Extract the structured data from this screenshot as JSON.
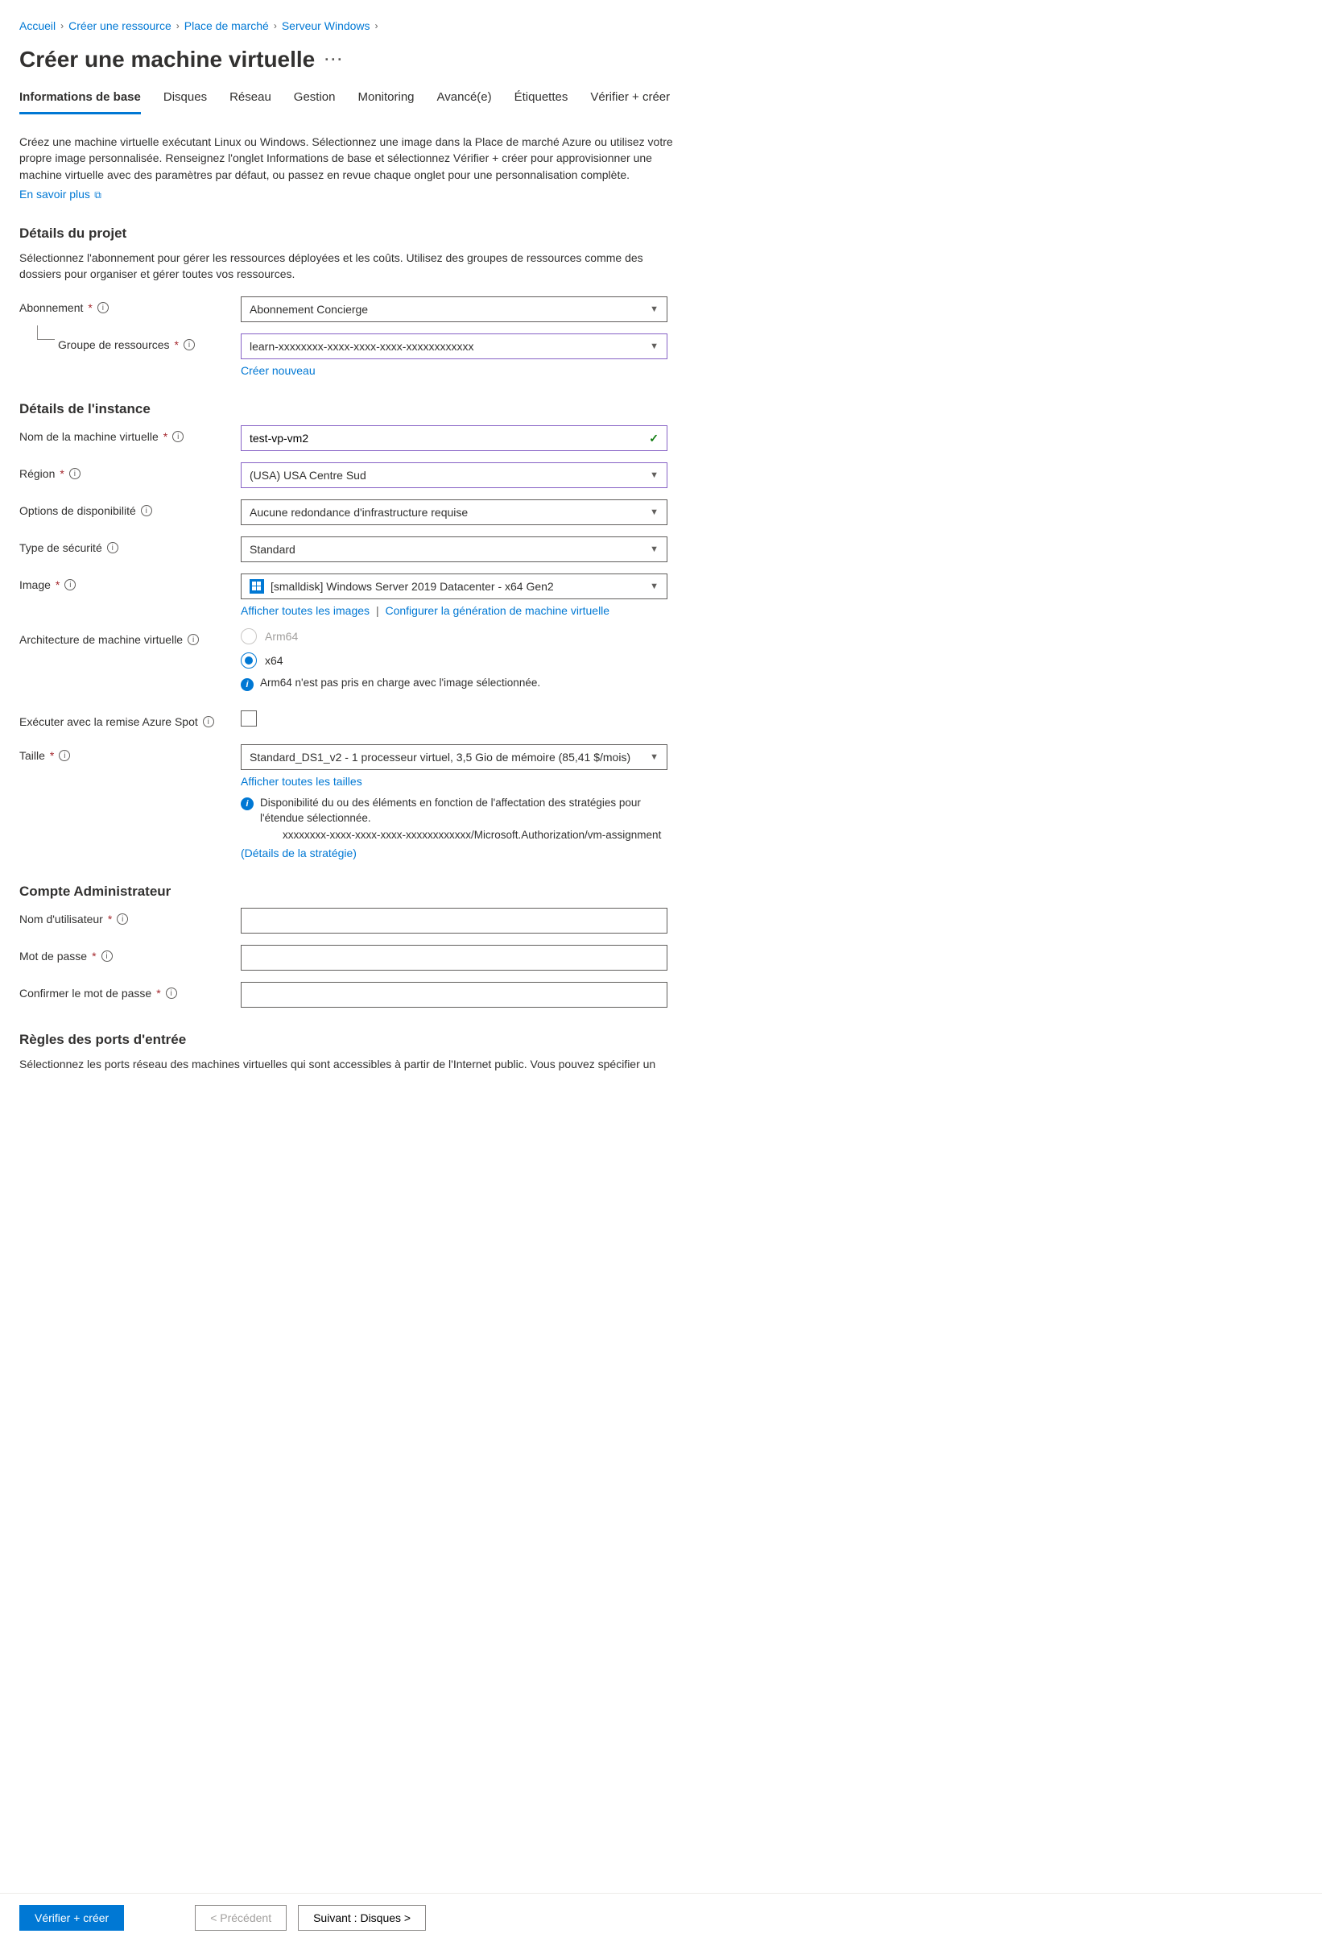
{
  "breadcrumb": [
    "Accueil",
    "Créer une ressource",
    "Place de marché",
    "Serveur Windows"
  ],
  "title": "Créer une machine virtuelle",
  "tabs": [
    "Informations de base",
    "Disques",
    "Réseau",
    "Gestion",
    "Monitoring",
    "Avancé(e)",
    "Étiquettes",
    "Vérifier + créer"
  ],
  "intro": "Créez une machine virtuelle exécutant Linux ou Windows. Sélectionnez une image dans la Place de marché Azure ou utilisez votre propre image personnalisée. Renseignez l'onglet Informations de base et sélectionnez Vérifier + créer pour approvisionner une machine virtuelle avec des paramètres par défaut, ou passez en revue chaque onglet pour une personnalisation complète.",
  "learn_more": "En savoir plus",
  "sections": {
    "project": {
      "title": "Détails du projet",
      "desc": "Sélectionnez l'abonnement pour gérer les ressources déployées et les coûts. Utilisez des groupes de ressources comme des dossiers pour organiser et gérer toutes vos ressources.",
      "subscription_label": "Abonnement",
      "subscription_value": "Abonnement Concierge",
      "rg_label": "Groupe de ressources",
      "rg_value": "learn-xxxxxxxx-xxxx-xxxx-xxxx-xxxxxxxxxxxx",
      "rg_new": "Créer nouveau"
    },
    "instance": {
      "title": "Détails de l'instance",
      "vmname_label": "Nom de la machine virtuelle",
      "vmname_value": "test-vp-vm2",
      "region_label": "Région",
      "region_value": "(USA) USA Centre Sud",
      "avail_label": "Options de disponibilité",
      "avail_value": "Aucune redondance d'infrastructure requise",
      "sectype_label": "Type de sécurité",
      "sectype_value": "Standard",
      "image_label": "Image",
      "image_value": "[smalldisk] Windows Server 2019 Datacenter - x64 Gen2",
      "image_link_all": "Afficher toutes les images",
      "image_link_cfg": "Configurer la génération de machine virtuelle",
      "arch_label": "Architecture de machine virtuelle",
      "arch_arm": "Arm64",
      "arch_x64": "x64",
      "arch_info": "Arm64 n'est pas pris en charge avec l'image sélectionnée.",
      "spot_label": "Exécuter avec la remise Azure Spot",
      "size_label": "Taille",
      "size_value": "Standard_DS1_v2 - 1 processeur virtuel, 3,5 Gio de mémoire (85,41 $/mois)",
      "size_link": "Afficher toutes les tailles",
      "size_info1": "Disponibilité du ou des éléments en fonction de l'affectation des stratégies pour l'étendue sélectionnée.",
      "size_info2": "xxxxxxxx-xxxx-xxxx-xxxx-xxxxxxxxxxxx/Microsoft.Authorization/vm-assignment",
      "size_info_link": "(Détails de la stratégie)"
    },
    "admin": {
      "title": "Compte Administrateur",
      "user_label": "Nom d'utilisateur",
      "pass_label": "Mot de passe",
      "confirm_label": "Confirmer le mot de passe"
    },
    "ports": {
      "title": "Règles des ports d'entrée",
      "desc": "Sélectionnez les ports réseau des machines virtuelles qui sont accessibles à partir de l'Internet public. Vous pouvez spécifier un"
    }
  },
  "footer": {
    "review": "Vérifier + créer",
    "prev": "< Précédent",
    "next": "Suivant : Disques >"
  }
}
